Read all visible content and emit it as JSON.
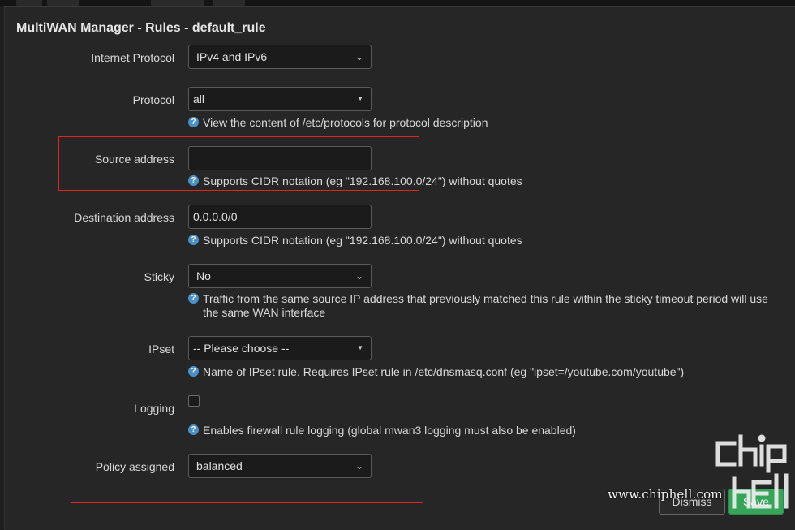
{
  "modal": {
    "title": "MultiWAN Manager - Rules - default_rule"
  },
  "form": {
    "internet_protocol": {
      "label": "Internet Protocol",
      "value": "IPv4 and IPv6"
    },
    "protocol": {
      "label": "Protocol",
      "value": "all",
      "help": "View the content of /etc/protocols for protocol description"
    },
    "source_address": {
      "label": "Source address",
      "value": "",
      "help": "Supports CIDR notation (eg \"192.168.100.0/24\") without quotes"
    },
    "destination_address": {
      "label": "Destination address",
      "value": "0.0.0.0/0",
      "help": "Supports CIDR notation (eg \"192.168.100.0/24\") without quotes"
    },
    "sticky": {
      "label": "Sticky",
      "value": "No",
      "help_line1": "Traffic from the same source IP address that previously matched this rule within the sticky timeout period will use",
      "help_line2": "the same WAN interface"
    },
    "ipset": {
      "label": "IPset",
      "value": "-- Please choose --",
      "help": "Name of IPset rule. Requires IPset rule in /etc/dnsmasq.conf (eg \"ipset=/youtube.com/youtube\")"
    },
    "logging": {
      "label": "Logging",
      "checked": false,
      "help": "Enables firewall rule logging (global mwan3 logging must also be enabled)"
    },
    "policy_assigned": {
      "label": "Policy assigned",
      "value": "balanced"
    }
  },
  "footer": {
    "dismiss_label": "Dismiss",
    "save_label": "Save"
  },
  "watermark": {
    "url": "www.chiphell.com",
    "logo": "chiphell-logo"
  },
  "colors": {
    "background": "#262626",
    "highlight_red": "#e0251b",
    "help_icon": "#4a90c8",
    "save_green": "#35a55a"
  },
  "icons": {
    "help": "question-circle-icon",
    "select_caret": "chevron-down-icon",
    "native_caret": "triangle-down-icon"
  }
}
